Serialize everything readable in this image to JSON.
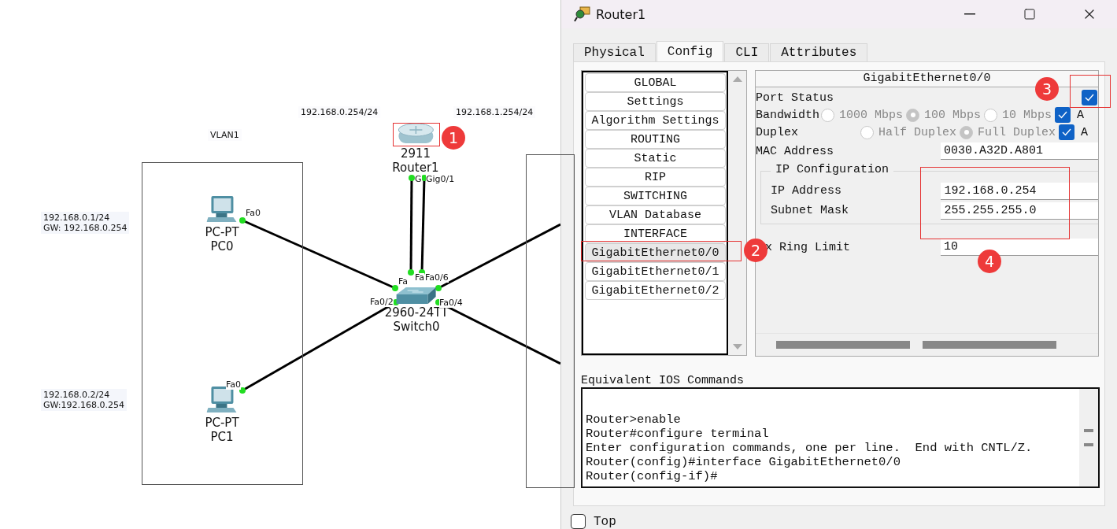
{
  "topology": {
    "notes": [
      {
        "lines": [
          "192.168.0.254/24"
        ]
      },
      {
        "lines": [
          "192.168.1.254/24"
        ]
      },
      {
        "lines": [
          "VLAN1"
        ]
      },
      {
        "lines": [
          "192.168.0.1/24",
          "GW:  192.168.0.254"
        ]
      },
      {
        "lines": [
          "192.168.0.2/24",
          "GW:192.168.0.254"
        ]
      }
    ],
    "devices": [
      {
        "kind": "router",
        "model": "2911",
        "name": "Router1"
      },
      {
        "kind": "switch",
        "model": "2960-24TT",
        "name": "Switch0"
      },
      {
        "kind": "pc",
        "model": "PC-PT",
        "name": "PC0"
      },
      {
        "kind": "pc",
        "model": "PC-PT",
        "name": "PC1"
      }
    ],
    "port_labels": [
      "Fa0",
      "Fa0",
      "G",
      "Gig0/1",
      "Fa",
      "Fa",
      "Fa0/6",
      "Fa0/2",
      "Fa0/4"
    ]
  },
  "window": {
    "title": "Router1"
  },
  "tabs": [
    {
      "label": "Physical",
      "selected": false
    },
    {
      "label": "Config",
      "selected": true
    },
    {
      "label": "CLI",
      "selected": false
    },
    {
      "label": "Attributes",
      "selected": false
    }
  ],
  "sidebar": {
    "items": [
      {
        "label": "GLOBAL",
        "selected": false
      },
      {
        "label": "Settings",
        "selected": false
      },
      {
        "label": "Algorithm Settings",
        "selected": false
      },
      {
        "label": "ROUTING",
        "selected": false
      },
      {
        "label": "Static",
        "selected": false
      },
      {
        "label": "RIP",
        "selected": false
      },
      {
        "label": "SWITCHING",
        "selected": false
      },
      {
        "label": "VLAN Database",
        "selected": false
      },
      {
        "label": "INTERFACE",
        "selected": false
      },
      {
        "label": "GigabitEthernet0/0",
        "selected": true
      },
      {
        "label": "GigabitEthernet0/1",
        "selected": false
      },
      {
        "label": "GigabitEthernet0/2",
        "selected": false
      }
    ]
  },
  "interface": {
    "title": "GigabitEthernet0/0",
    "port_status": {
      "label": "Port Status",
      "checked": true
    },
    "bandwidth": {
      "label": "Bandwidth",
      "disabled": true,
      "options": [
        {
          "label": "1000 Mbps",
          "selected": false
        },
        {
          "label": "100 Mbps",
          "selected": true
        },
        {
          "label": "10 Mbps",
          "selected": false
        }
      ],
      "auto": {
        "label": "A",
        "checked": true
      }
    },
    "duplex": {
      "label": "Duplex",
      "disabled": true,
      "options": [
        {
          "label": "Half Duplex",
          "selected": false
        },
        {
          "label": "Full Duplex",
          "selected": true
        }
      ],
      "auto": {
        "label": "A",
        "checked": true
      }
    },
    "mac": {
      "label": "MAC Address",
      "value": "0030.A32D.A801"
    },
    "ip_config": {
      "title": "IP Configuration",
      "fields": [
        {
          "label": "IP Address",
          "value": "192.168.0.254"
        },
        {
          "label": "Subnet Mask",
          "value": "255.255.255.0"
        }
      ]
    },
    "tx_ring": {
      "label": "x Ring Limit",
      "value": "10"
    }
  },
  "console": {
    "title": "Equivalent IOS Commands",
    "lines": [
      "Router>enable",
      "Router#configure terminal",
      "Enter configuration commands, one per line.  End with CNTL/Z.",
      "Router(config)#interface GigabitEthernet0/0",
      "Router(config-if)#"
    ]
  },
  "top": {
    "label": "Top",
    "checked": false
  },
  "annotations": [
    {
      "label": "1"
    },
    {
      "label": "2"
    },
    {
      "label": "3"
    },
    {
      "label": "4"
    }
  ]
}
